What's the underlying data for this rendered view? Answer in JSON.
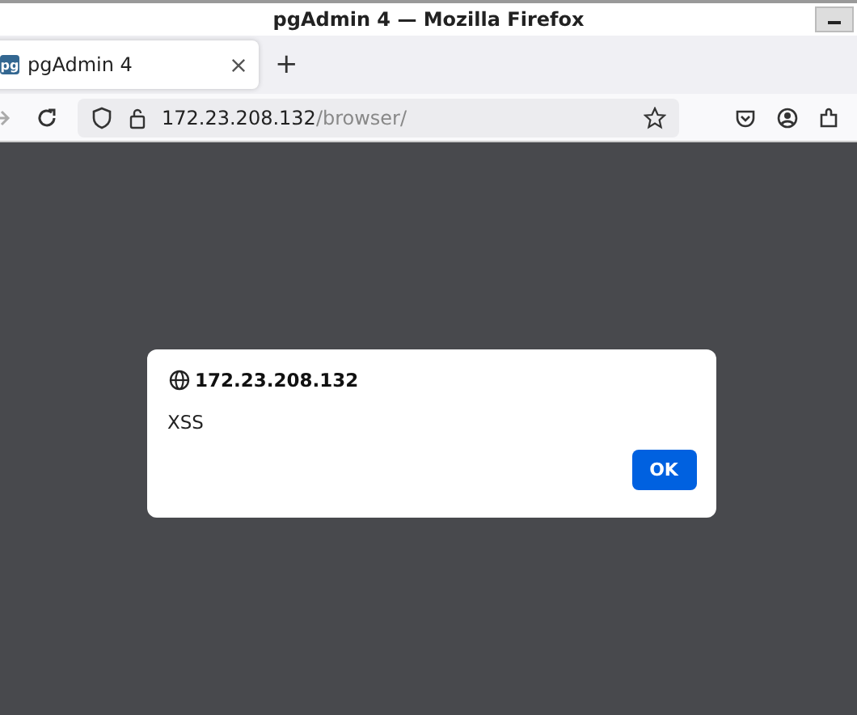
{
  "window": {
    "title": "pgAdmin 4 — Mozilla Firefox"
  },
  "tabs": [
    {
      "label": "pgAdmin 4",
      "favicon": "pg",
      "selected": true
    }
  ],
  "new_tab": "+",
  "address_bar": {
    "host": "172.23.208.132",
    "path": "/browser/"
  },
  "dialog": {
    "origin": "172.23.208.132",
    "message": "XSS",
    "button": "OK"
  }
}
